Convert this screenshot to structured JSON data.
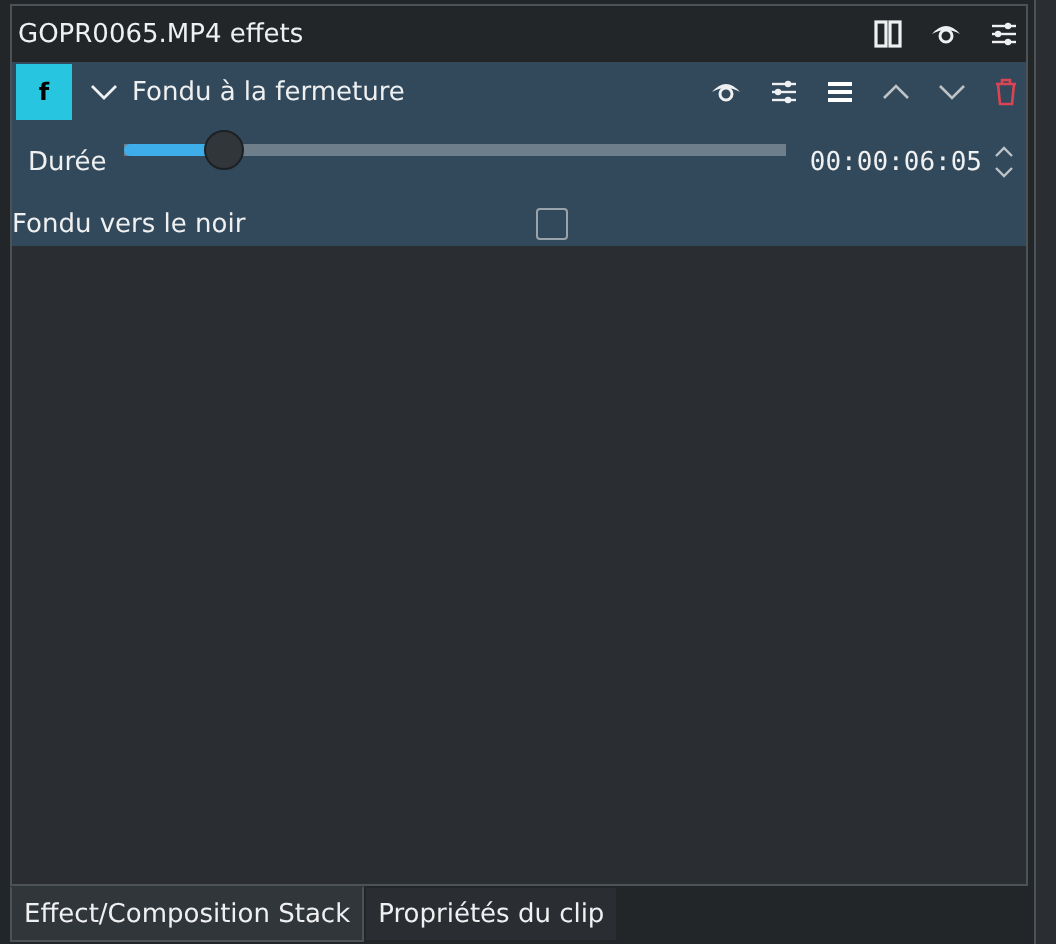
{
  "panel": {
    "title": "GOPR0065.MP4 effets"
  },
  "effect": {
    "badge": "f",
    "name": "Fondu à la fermeture",
    "expanded": true,
    "enabled": true,
    "params": [
      {
        "kind": "slider",
        "label": "Durée",
        "level": 0.15,
        "value": "00:00:06:05"
      },
      {
        "kind": "checkbox",
        "label": "Fondu vers le noir",
        "checked": false
      }
    ]
  },
  "tabs": [
    {
      "label": "Effect/Composition Stack",
      "selected": true
    },
    {
      "label": "Propriétés du clip",
      "selected": false
    }
  ]
}
